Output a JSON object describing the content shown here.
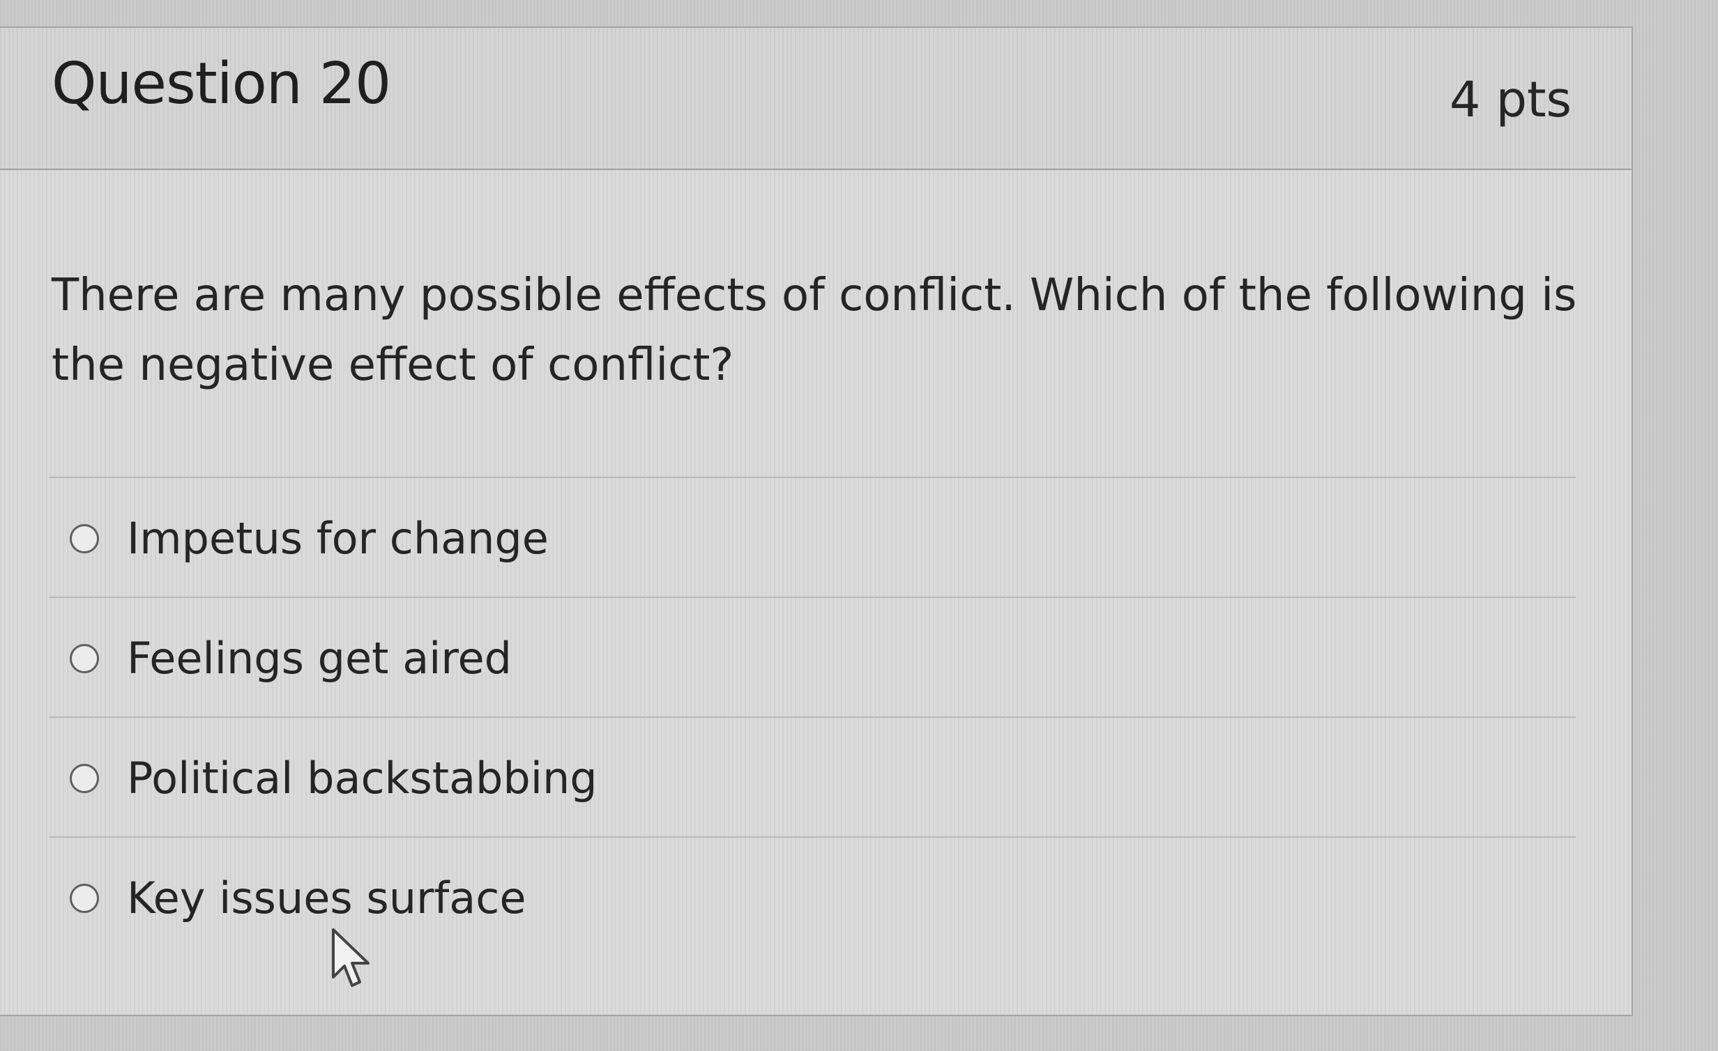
{
  "question": {
    "title": "Question 20",
    "points": "4 pts",
    "text": "There are many possible effects of conflict. Which of the following is the negative effect of conflict?"
  },
  "answers": [
    {
      "label": "Impetus for change",
      "selected": false
    },
    {
      "label": "Feelings get aired",
      "selected": false
    },
    {
      "label": "Political backstabbing",
      "selected": false
    },
    {
      "label": "Key issues surface",
      "selected": false
    }
  ],
  "cursor": {
    "icon": "mouse-pointer-icon"
  }
}
